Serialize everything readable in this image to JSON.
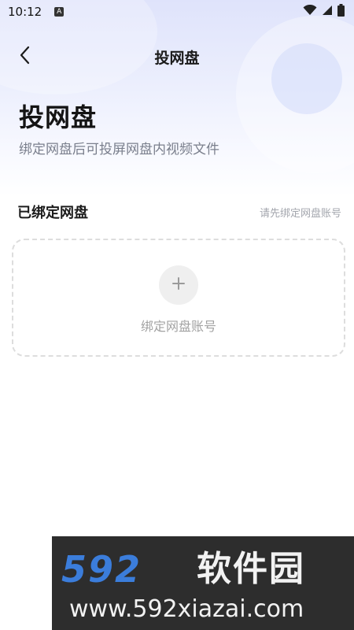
{
  "status_bar": {
    "time": "10:12",
    "notification_icon": "A"
  },
  "nav": {
    "title": "投网盘"
  },
  "hero": {
    "title": "投网盘",
    "subtitle": "绑定网盘后可投屏网盘内视频文件"
  },
  "section": {
    "label": "已绑定网盘",
    "hint": "请先绑定网盘账号"
  },
  "bind_card": {
    "label": "绑定网盘账号"
  },
  "watermark": {
    "logo_digits": "592",
    "brand": "软件园",
    "url": "www.592xiazai.com"
  },
  "colors": {
    "hero_gradient_top": "#dfe3fb",
    "muted_text": "#7a7f8c",
    "hint_text": "#a3a6ad",
    "dashed_border": "#dddddd",
    "watermark_bg": "#2d2d2d",
    "watermark_blue": "#3b7ddb"
  },
  "icons": {
    "back": "chevron-left-icon",
    "add": "plus-icon",
    "wifi": "wifi-icon",
    "signal": "signal-icon",
    "battery": "battery-icon"
  }
}
